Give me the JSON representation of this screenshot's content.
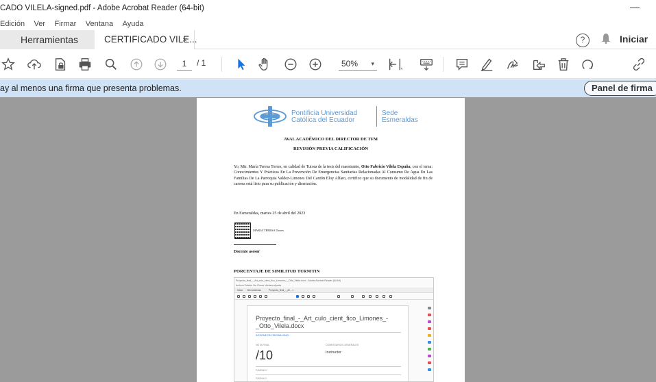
{
  "window": {
    "title": "CADO VILELA-signed.pdf - Adobe Acrobat Reader (64-bit)",
    "minimize_label": "—"
  },
  "menu": {
    "items": [
      "Edición",
      "Ver",
      "Firmar",
      "Ventana",
      "Ayuda"
    ]
  },
  "tabs": {
    "tools_label": "Herramientas",
    "doc_label": "CERTIFICADO VILE...",
    "close_label": "×",
    "help_label": "?",
    "signin_label": "Iniciar"
  },
  "toolbar": {
    "page_current": "1",
    "page_total": "/ 1",
    "zoom": "50%",
    "zoom_caret": "▾",
    "icons": [
      "star-icon",
      "upload-cloud-icon",
      "file-lock-icon",
      "print-icon",
      "zoom-search-icon",
      "page-up-icon",
      "page-down-icon",
      "select-cursor-icon",
      "hand-icon",
      "zoom-out-icon",
      "zoom-in-icon",
      "fit-page-icon",
      "keyboard-icon",
      "comment-icon",
      "highlight-pen-icon",
      "sign-icon",
      "share-icon",
      "delete-icon",
      "rotate-icon",
      "link-icon"
    ]
  },
  "signature_bar": {
    "message": "ay al menos una firma que presenta problemas.",
    "panel_button": "Panel de firma"
  },
  "document": {
    "logo": {
      "uni_line1": "Pontificia Universidad",
      "uni_line2": "Católica del Ecuador",
      "sede_line1": "Sede",
      "sede_line2": "Esmeraldas"
    },
    "heading1": "AVAL ACADÉMICO DEL DIRECTOR DE TFM",
    "heading2": "REVISIÓN PREVIA CALIFICACIÓN",
    "paragraph_pre": "Yo, Mtr. María Teresa Torres, en calidad de Tutora de la tesis del maestrante, ",
    "paragraph_bold": "Otto Fabricio Vilela España",
    "paragraph_post": ", con el tema: Conocimientos Y Prácticas En La Prevención De Emergencias Sanitarias Relacionadas Al Consumo De Agua En Las Familias De La Parroquia Valdez-Limones Del Cantón Eloy Alfaro, certifico que su documento de modalidad de fin de carrera está listo para su publicación y disertación.",
    "date_line": "En Esmeraldas, martes 25 de abril del 2023",
    "qr_name": "MARIA TERESA Torres",
    "signer_role": "Docente asesor",
    "turnitin_heading": "PORCENTAJE DE SIMILITUD TURNITIN",
    "screenshot": {
      "title": "Proyecto_final_-_Art_culo_cient_fico_Limones_-_Otto_Vilela.docx - Adobe Acrobat Reader (64-bit)",
      "menu": "Archivo  Edición  Ver  Firmar  Ventana  Ayuda",
      "tab1": "Inicio",
      "tab2": "Herramientas",
      "tab3": "Proyecto_final_-_Ar... ×",
      "filename": "Proyecto_final_-_Art_culo_cient_fico_Limones_-_Otto_Vilela.docx",
      "report_label": "INFORME DE ORIGINALIDAD",
      "grade_label": "NOTA FINAL",
      "comments_label": "COMENTARIOS GENERALES",
      "score": "/10",
      "instructor": "Instructor",
      "page1": "PÁGINA 1",
      "page2": "PÁGINA 2"
    }
  },
  "colors": {
    "accent": "#5b9bd5",
    "signature_bar": "#cfe2f6",
    "viewer_bg": "#9b9b9b",
    "select_tool": "#1473e6"
  }
}
